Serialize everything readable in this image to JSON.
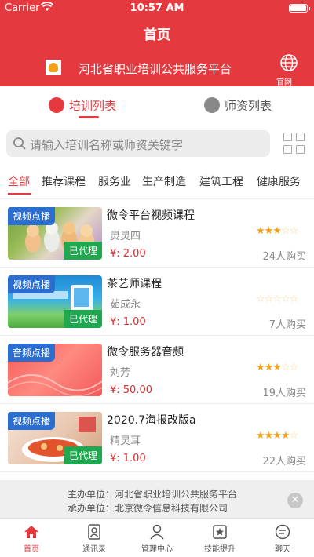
{
  "status_bar": {
    "carrier": "Carrier",
    "time": "10:57 AM"
  },
  "header": {
    "title": "首页",
    "org_name": "河北省职业培训公共服务平台",
    "website_label": "官网"
  },
  "tabs": [
    {
      "label": "培训列表",
      "active": true,
      "icon": "book-icon"
    },
    {
      "label": "师资列表",
      "active": false,
      "icon": "teacher-icon"
    }
  ],
  "search": {
    "placeholder": "请输入培训名称或师资关键字"
  },
  "categories": [
    {
      "label": "全部",
      "active": true
    },
    {
      "label": "推荐课程"
    },
    {
      "label": "服务业"
    },
    {
      "label": "生产制造"
    },
    {
      "label": "建筑工程"
    },
    {
      "label": "健康服务"
    }
  ],
  "courses": [
    {
      "type": "视频点播",
      "title": "微令平台视频课程",
      "teacher": "灵灵四",
      "price": "¥: 2.00",
      "rating": 3,
      "buyers": "24人购买",
      "agent": "已代理",
      "thumb": "cats"
    },
    {
      "type": "视频点播",
      "title": "茶艺师课程",
      "teacher": "茹成永",
      "price": "¥: 1.00",
      "rating": 0,
      "buyers": "7人购买",
      "agent": "已代理",
      "thumb": "blue"
    },
    {
      "type": "音频点播",
      "title": "微令服务器音频",
      "teacher": "刘芳",
      "price": "¥: 50.00",
      "rating": 3,
      "buyers": "19人购买",
      "agent": "",
      "thumb": "red"
    },
    {
      "type": "视频点播",
      "title": "2020.7海报改版a",
      "teacher": "精灵耳",
      "price": "¥: 1.00",
      "rating": 4,
      "buyers": "22人购买",
      "agent": "已代理",
      "thumb": "food"
    }
  ],
  "footer": {
    "host": "主办单位：河北省职业培训公共服务平台",
    "organizer": "承办单位：北京微令信息科技有限公司",
    "close": "✕"
  },
  "bottom_nav": [
    {
      "label": "首页",
      "active": true,
      "icon": "home-icon"
    },
    {
      "label": "通讯录",
      "icon": "contacts-icon"
    },
    {
      "label": "管理中心",
      "icon": "user-icon"
    },
    {
      "label": "技能提升",
      "icon": "skill-icon"
    },
    {
      "label": "聊天",
      "icon": "chat-icon"
    }
  ],
  "colors": {
    "brand": "#e43a3f",
    "type_badge": "#2c6ecf",
    "agent_badge": "#1fa84f",
    "star": "#f0a21a",
    "price": "#d32f2f"
  }
}
